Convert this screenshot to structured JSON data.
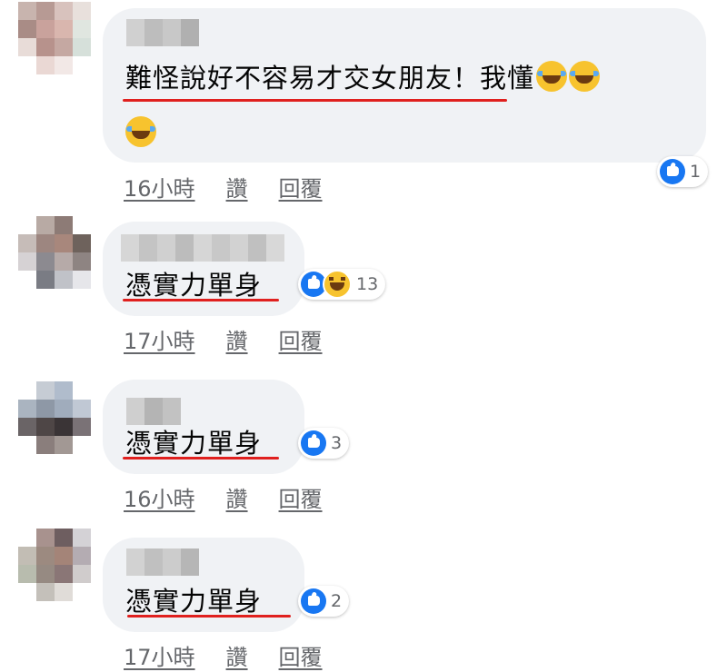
{
  "comments": [
    {
      "name_redacted": true,
      "text": "難怪說好不容易才交女朋友！我懂",
      "text_line2_emoji": "😂",
      "emoji": "laugh-tears",
      "reactions": {
        "types": [
          "like"
        ],
        "count": "1"
      },
      "time": "16小時",
      "like_label": "讚",
      "reply_label": "回覆"
    },
    {
      "name_redacted": true,
      "text": "憑實力單身",
      "reactions": {
        "types": [
          "like",
          "haha"
        ],
        "count": "13"
      },
      "time": "17小時",
      "like_label": "讚",
      "reply_label": "回覆"
    },
    {
      "name_redacted": true,
      "text": "憑實力單身",
      "reactions": {
        "types": [
          "like"
        ],
        "count": "3"
      },
      "time": "16小時",
      "like_label": "讚",
      "reply_label": "回覆"
    },
    {
      "name_redacted": true,
      "text": "憑實力單身",
      "reactions": {
        "types": [
          "like"
        ],
        "count": "2"
      },
      "time": "17小時",
      "like_label": "讚",
      "reply_label": "回覆"
    }
  ],
  "colors": {
    "bubble": "#f0f2f5",
    "underline": "#e0201e",
    "like": "#1877f2",
    "meta": "#65676b"
  }
}
